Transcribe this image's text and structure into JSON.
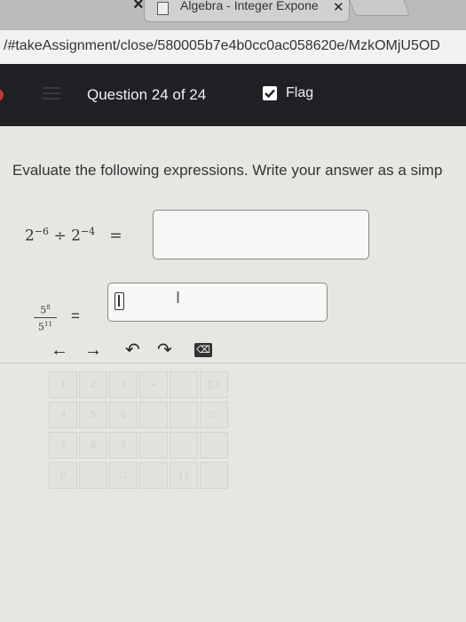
{
  "browser": {
    "tab_title": "Algebra - Integer Expone",
    "url": "/#takeAssignment/close/580005b7e4b0cc0ac058620e/MzkOMjU5OD"
  },
  "header": {
    "question_label": "Question 24 of 24",
    "flag_label": "Flag"
  },
  "main": {
    "instructions": "Evaluate the following expressions. Write your answer as a simp",
    "problem1": {
      "base1": "2",
      "exp1": "−6",
      "operator": "÷",
      "base2": "2",
      "exp2": "−4",
      "equals": "="
    },
    "problem2": {
      "numerator_base": "5",
      "numerator_exp": "8",
      "denominator_base": "5",
      "denominator_exp": "11",
      "equals": "="
    },
    "math_toolbar": {
      "left_arrow": "←",
      "right_arrow": "→",
      "undo": "↶",
      "redo": "↷",
      "backspace": "⌫"
    }
  },
  "keypad": {
    "keys": [
      "1",
      "2",
      "3",
      "+",
      "−",
      "[□]",
      "4",
      "5",
      "6",
      "",
      "",
      "□□",
      "7",
      "8",
      "9",
      "",
      "",
      "",
      "0",
      ".",
      "□",
      "",
      "( )",
      ""
    ]
  }
}
